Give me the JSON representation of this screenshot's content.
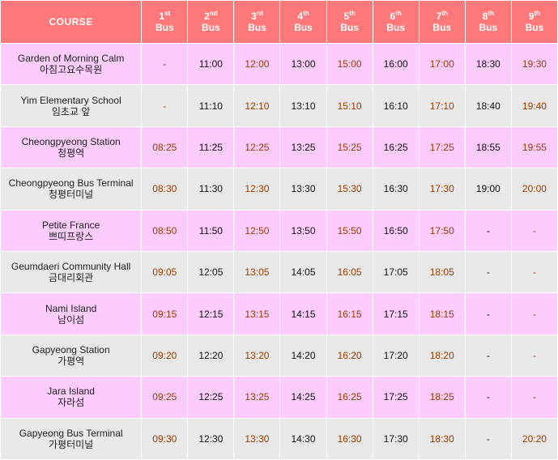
{
  "header": {
    "course_label": "COURSE",
    "bus_label": "Bus",
    "buses": [
      {
        "num": "1",
        "suffix": "st"
      },
      {
        "num": "2",
        "suffix": "nd"
      },
      {
        "num": "3",
        "suffix": "rd"
      },
      {
        "num": "4",
        "suffix": "th"
      },
      {
        "num": "5",
        "suffix": "th"
      },
      {
        "num": "6",
        "suffix": "th"
      },
      {
        "num": "7",
        "suffix": "th"
      },
      {
        "num": "8",
        "suffix": "th"
      },
      {
        "num": "9",
        "suffix": "th"
      }
    ]
  },
  "colors": {
    "header_bg": "#ff787a",
    "pink_row": "#ffccff",
    "gray_row": "#e9e9e9",
    "red_time": "#a03c00"
  },
  "rows": [
    {
      "en": "Garden of Morning Calm",
      "ko": "아침고요수목원",
      "times": [
        "-",
        "11:00",
        "12:00",
        "13:00",
        "15:00",
        "16:00",
        "17:00",
        "18:30",
        "19:30"
      ]
    },
    {
      "en": "Yim Elementary School",
      "ko": "임초교 앞",
      "times": [
        "-",
        "11:10",
        "12:10",
        "13:10",
        "15:10",
        "16:10",
        "17:10",
        "18:40",
        "19:40"
      ]
    },
    {
      "en": "Cheongpyeong Station",
      "ko": "청평역",
      "times": [
        "08:25",
        "11:25",
        "12:25",
        "13:25",
        "15:25",
        "16:25",
        "17:25",
        "18:55",
        "19:55"
      ]
    },
    {
      "en": "Cheongpyeong Bus Terminal",
      "ko": "청평터미널",
      "times": [
        "08:30",
        "11:30",
        "12:30",
        "13:30",
        "15:30",
        "16:30",
        "17:30",
        "19:00",
        "20:00"
      ]
    },
    {
      "en": "Petite France",
      "ko": "쁘띠프랑스",
      "times": [
        "08:50",
        "11:50",
        "12:50",
        "13:50",
        "15:50",
        "16:50",
        "17:50",
        "-",
        "-"
      ]
    },
    {
      "en": "Geumdaeri Community Hall",
      "ko": "금대리회관",
      "times": [
        "09:05",
        "12:05",
        "13:05",
        "14:05",
        "16:05",
        "17:05",
        "18:05",
        "-",
        "-"
      ]
    },
    {
      "en": "Nami Island",
      "ko": "남이섬",
      "times": [
        "09:15",
        "12:15",
        "13:15",
        "14:15",
        "16:15",
        "17:15",
        "18:15",
        "-",
        "-"
      ]
    },
    {
      "en": "Gapyeong Station",
      "ko": "가평역",
      "times": [
        "09:20",
        "12:20",
        "13:20",
        "14:20",
        "16:20",
        "17:20",
        "18:20",
        "-",
        "-"
      ]
    },
    {
      "en": "Jara Island",
      "ko": "자라섬",
      "times": [
        "09:25",
        "12:25",
        "13:25",
        "14:25",
        "16:25",
        "17:25",
        "18:25",
        "-",
        "-"
      ]
    },
    {
      "en": "Gapyeong Bus Terminal",
      "ko": "가평터미널",
      "times": [
        "09:30",
        "12:30",
        "13:30",
        "14:30",
        "16:30",
        "17:30",
        "18:30",
        "-",
        "20:20"
      ]
    }
  ]
}
